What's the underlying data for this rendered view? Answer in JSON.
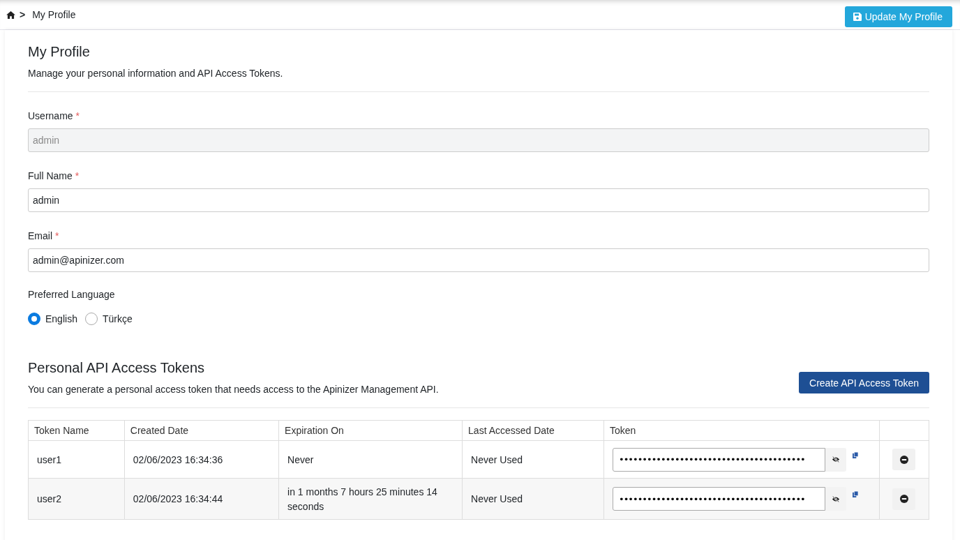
{
  "breadcrumb": {
    "separator": ">",
    "current": "My Profile"
  },
  "update_button": "Update My Profile",
  "profile": {
    "title": "My Profile",
    "subtitle": "Manage your personal information and API Access Tokens.",
    "fields": [
      {
        "label": "Username",
        "mark": "*",
        "value": "admin",
        "disabled": true
      },
      {
        "label": "Full Name",
        "mark": "*",
        "value": "admin",
        "disabled": false
      },
      {
        "label": "Email",
        "mark": "*",
        "value": "admin@apinizer.com",
        "disabled": false
      }
    ],
    "language": {
      "label": "Preferred Language",
      "options": [
        {
          "label": "English",
          "selected": true
        },
        {
          "label": "Türkçe",
          "selected": false
        }
      ]
    }
  },
  "tokens": {
    "title": "Personal API Access Tokens",
    "subtitle": "You can generate a personal access token that needs access to the Apinizer Management API.",
    "create_button": "Create API Access Token",
    "columns": [
      "Token Name",
      "Created Date",
      "Expiration On",
      "Last Accessed Date",
      "Token"
    ],
    "rows": [
      {
        "name": "user1",
        "created": "02/06/2023 16:34:36",
        "expiration": "Never",
        "last_accessed": "Never Used",
        "token": "••••••••••••••••••••••••••••••••••••••••"
      },
      {
        "name": "user2",
        "created": "02/06/2023 16:34:44",
        "expiration": "in 1 months 7 hours 25 minutes 14 seconds",
        "last_accessed": "Never Used",
        "token": "••••••••••••••••••••••••••••••••••••••••"
      }
    ]
  }
}
